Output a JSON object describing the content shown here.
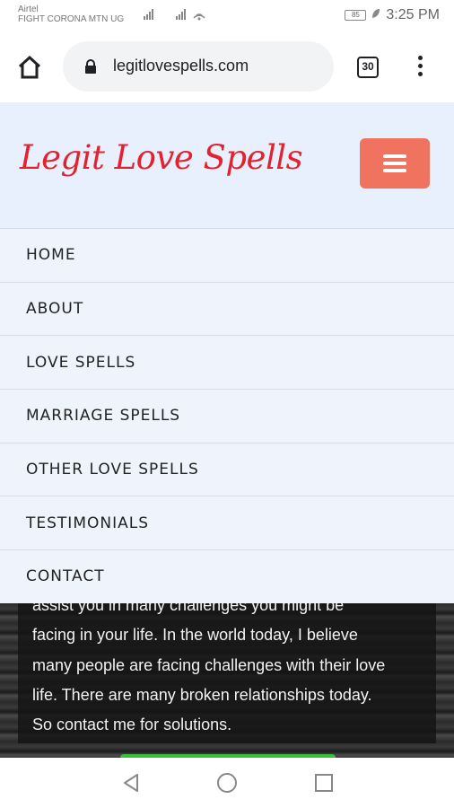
{
  "status_bar": {
    "carrier_name": "Airtel",
    "carrier_sub": "FIGHT CORONA MTN UG",
    "battery": "85",
    "time": "3:25 PM"
  },
  "browser": {
    "url": "legitlovespells.com",
    "tab_count": "30"
  },
  "site": {
    "logo": "Legit Love Spells"
  },
  "nav": {
    "items": [
      {
        "label": "HOME"
      },
      {
        "label": "ABOUT"
      },
      {
        "label": "LOVE SPELLS"
      },
      {
        "label": "MARRIAGE SPELLS"
      },
      {
        "label": "OTHER LOVE SPELLS"
      },
      {
        "label": "TESTIMONIALS"
      },
      {
        "label": "CONTACT"
      }
    ]
  },
  "hero": {
    "lines": [
      "assist you in many challenges you might be",
      "facing in your life. In the world today, I believe",
      "many people are facing challenges with their love",
      "life. There are many broken relationships today.",
      "So contact me for solutions."
    ]
  }
}
